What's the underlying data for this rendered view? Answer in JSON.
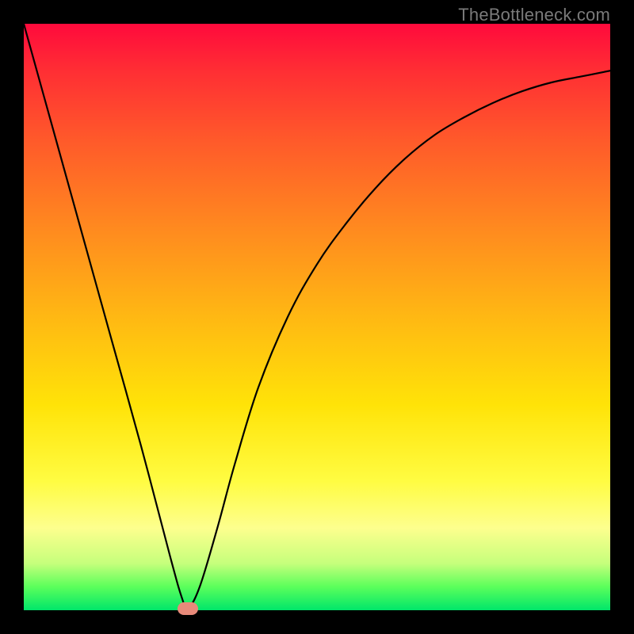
{
  "watermark": "TheBottleneck.com",
  "chart_data": {
    "type": "line",
    "title": "",
    "xlabel": "",
    "ylabel": "",
    "xlim": [
      0,
      100
    ],
    "ylim": [
      0,
      100
    ],
    "grid": false,
    "legend": false,
    "gradient_stops": [
      {
        "pos": 0,
        "color": "#ff0a3c"
      },
      {
        "pos": 8,
        "color": "#ff2e34"
      },
      {
        "pos": 20,
        "color": "#ff5a2a"
      },
      {
        "pos": 35,
        "color": "#ff8a1f"
      },
      {
        "pos": 50,
        "color": "#ffb813"
      },
      {
        "pos": 65,
        "color": "#ffe308"
      },
      {
        "pos": 78,
        "color": "#fffc42"
      },
      {
        "pos": 86,
        "color": "#fdff8e"
      },
      {
        "pos": 92,
        "color": "#c6ff7c"
      },
      {
        "pos": 96,
        "color": "#5bff5b"
      },
      {
        "pos": 100,
        "color": "#00e66a"
      }
    ],
    "series": [
      {
        "name": "bottleneck-curve",
        "x": [
          0,
          5,
          10,
          15,
          20,
          25,
          27,
          28,
          30,
          33,
          36,
          40,
          45,
          50,
          55,
          60,
          65,
          70,
          75,
          80,
          85,
          90,
          95,
          100
        ],
        "y": [
          100,
          82,
          64,
          46,
          28,
          9,
          2,
          0.3,
          4,
          14,
          25,
          38,
          50,
          59,
          66,
          72,
          77,
          81,
          84,
          86.5,
          88.5,
          90,
          91,
          92
        ]
      }
    ],
    "marker": {
      "x": 28,
      "y": 0.3,
      "color": "#e88a7a"
    }
  }
}
